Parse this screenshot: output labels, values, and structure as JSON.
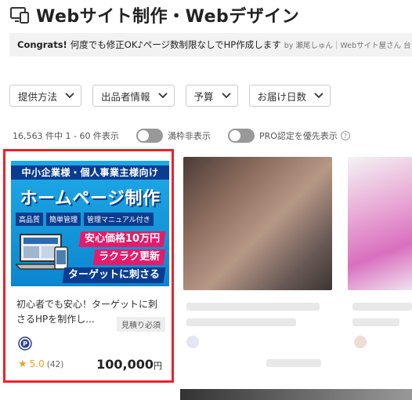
{
  "header": {
    "title": "Webサイト制作・Webデザイン",
    "icon": "monitor-icon"
  },
  "banner": {
    "bold": "Congrats!",
    "text": "何度でも修正OK♪ページ数制限なしでHP作成します",
    "author": "by 瀬尾しゅん｜Webサイト屋さん 台"
  },
  "filters": [
    {
      "label": "提供方法"
    },
    {
      "label": "出品者情報"
    },
    {
      "label": "予算"
    },
    {
      "label": "お届け日数"
    }
  ],
  "results": {
    "count_text": "16,563 件中 1 - 60 件表示",
    "toggle1_label": "満枠非表示",
    "toggle2_label": "PRO認定を優先表示"
  },
  "card": {
    "thumb": {
      "band": "中小企業様・個人事業主様向け",
      "main": "ホームページ制作",
      "tags": [
        "高品質",
        "簡単管理",
        "管理マニュアル付き"
      ],
      "line1": "安心価格10万円",
      "line2": "ラクラク更新",
      "line3": "ターゲットに刺さる"
    },
    "desc": "初心者でも安心！ターゲットに刺さるHPを制作し...",
    "badge": "見積り必須",
    "rating": {
      "score": "5.0",
      "count": "(42)"
    },
    "price": "100,000",
    "currency": "円",
    "pro_icon": "pro-badge-icon"
  },
  "colors": {
    "highlight": "#e8232a",
    "star": "#f1a21b",
    "accent": "#0a3d91"
  }
}
